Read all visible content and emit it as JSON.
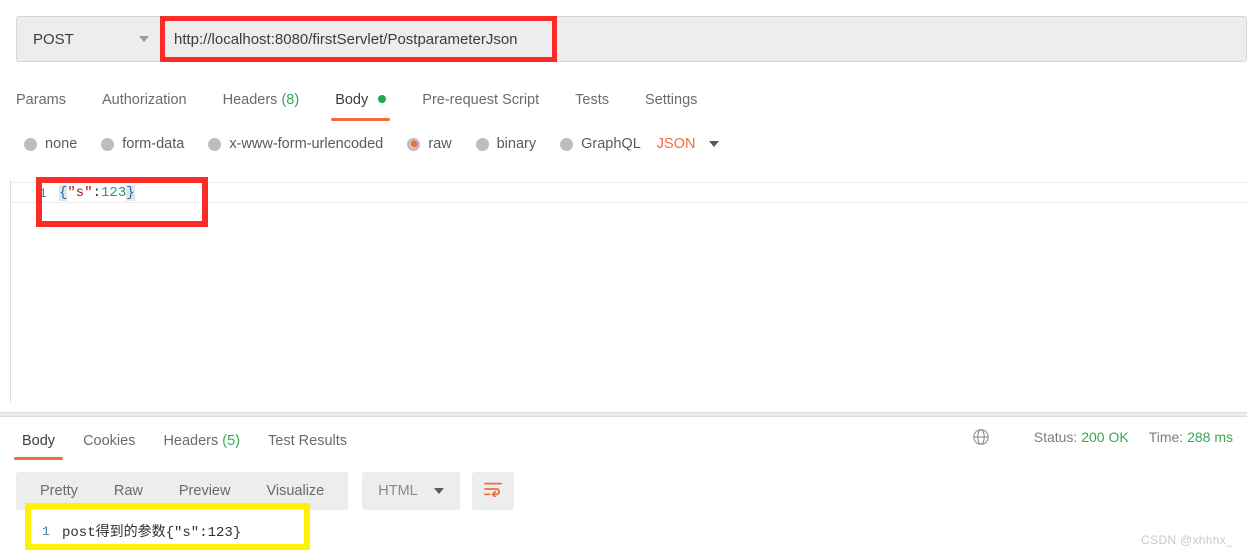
{
  "request": {
    "method": "POST",
    "url": "http://localhost:8080/firstServlet/PostparameterJson",
    "url_placeholder": "Enter request URL",
    "tabs": [
      {
        "label": "Params",
        "count": "",
        "active": false,
        "dot": false
      },
      {
        "label": "Authorization",
        "count": "",
        "active": false,
        "dot": false
      },
      {
        "label": "Headers",
        "count": "(8)",
        "active": false,
        "dot": false
      },
      {
        "label": "Body",
        "count": "",
        "active": true,
        "dot": true
      },
      {
        "label": "Pre-request Script",
        "count": "",
        "active": false,
        "dot": false
      },
      {
        "label": "Tests",
        "count": "",
        "active": false,
        "dot": false
      },
      {
        "label": "Settings",
        "count": "",
        "active": false,
        "dot": false
      }
    ],
    "body_types": [
      {
        "label": "none",
        "selected": false
      },
      {
        "label": "form-data",
        "selected": false
      },
      {
        "label": "x-www-form-urlencoded",
        "selected": false
      },
      {
        "label": "raw",
        "selected": true
      },
      {
        "label": "binary",
        "selected": false
      },
      {
        "label": "GraphQL",
        "selected": false
      }
    ],
    "raw_format": "JSON",
    "editor": {
      "line_number": "1",
      "open_brace": "{",
      "key": "\"s\"",
      "colon": ":",
      "value": "123",
      "close_brace": "}"
    }
  },
  "response": {
    "tabs": [
      {
        "label": "Body",
        "count": "",
        "active": true
      },
      {
        "label": "Cookies",
        "count": "",
        "active": false
      },
      {
        "label": "Headers",
        "count": "(5)",
        "active": false
      },
      {
        "label": "Test Results",
        "count": "",
        "active": false
      }
    ],
    "status_label": "Status:",
    "status_value": "200 OK",
    "time_label": "Time:",
    "time_value": "288 ms",
    "format_tabs": [
      {
        "label": "Pretty",
        "active": true
      },
      {
        "label": "Raw",
        "active": false
      },
      {
        "label": "Preview",
        "active": false
      },
      {
        "label": "Visualize",
        "active": false
      }
    ],
    "language": "HTML",
    "body": {
      "line_number": "1",
      "text": "post得到的参数{\"s\":123}"
    }
  },
  "colors": {
    "accent": "#f26b3a",
    "success": "#3aa757",
    "annotation_red": "#fb2b27",
    "annotation_yellow": "#fff200",
    "chrome_grey": "#ededed"
  },
  "watermark": "CSDN @xhhhx_"
}
